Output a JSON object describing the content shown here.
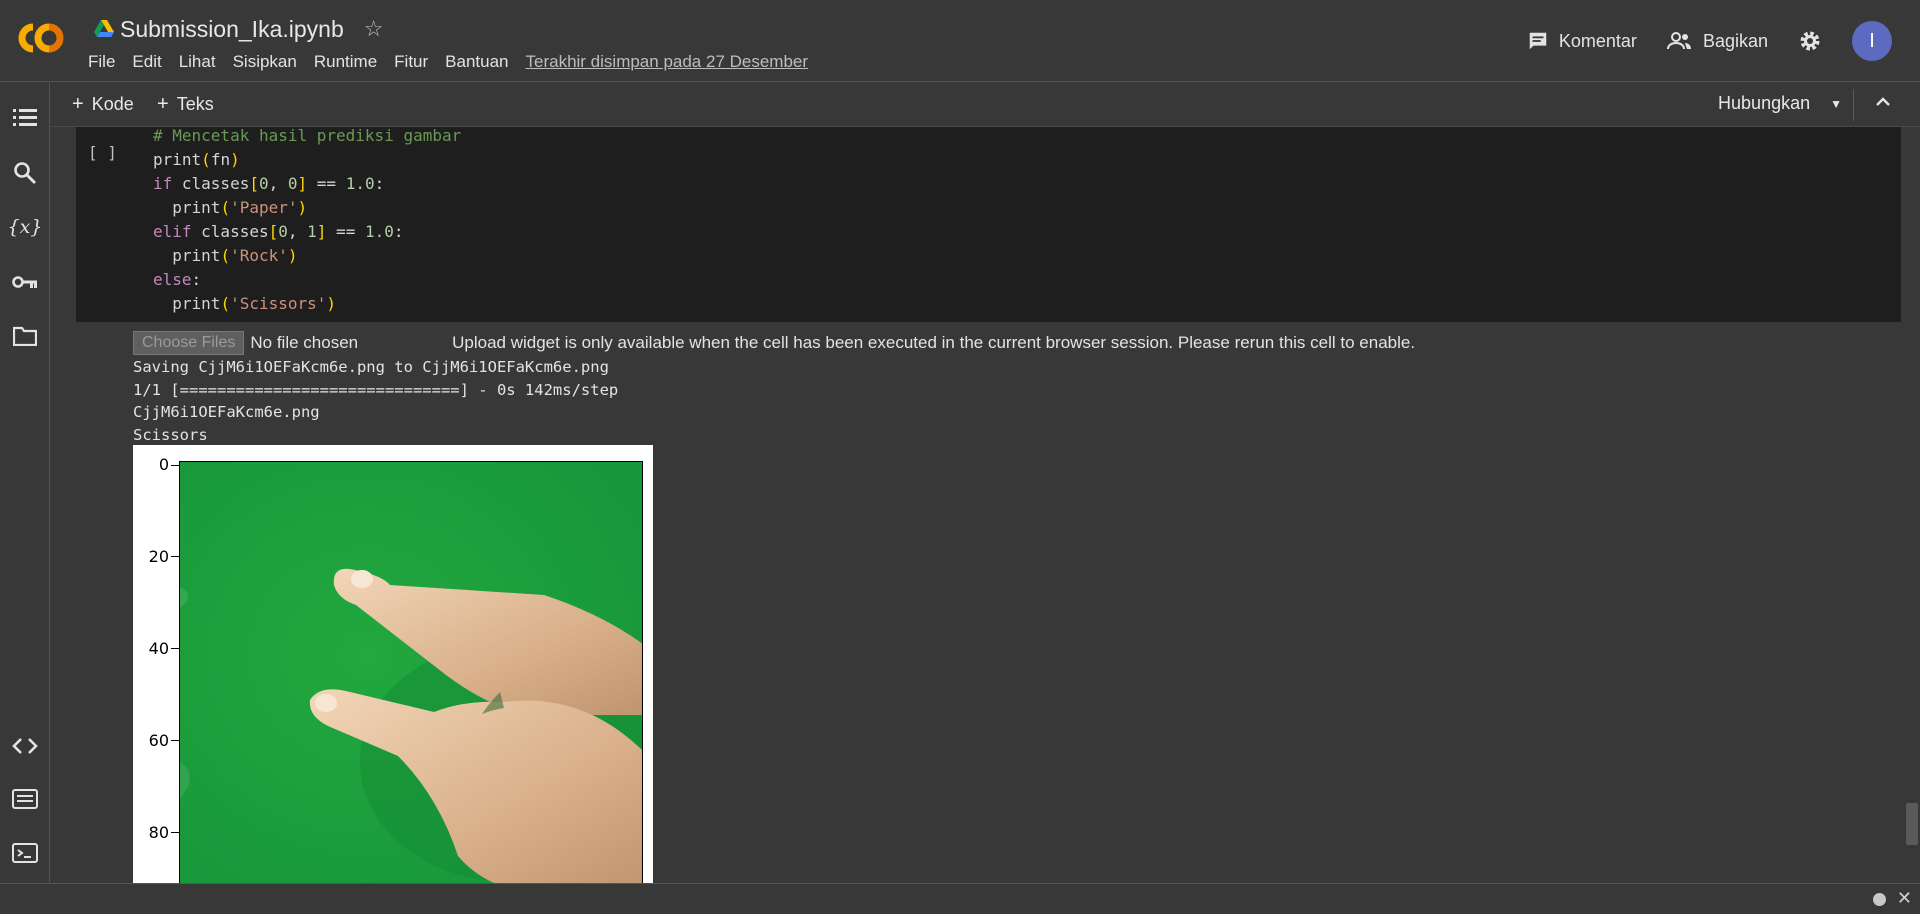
{
  "header": {
    "title": "Submission_Ika.ipynb",
    "menu": [
      "File",
      "Edit",
      "Lihat",
      "Sisipkan",
      "Runtime",
      "Fitur",
      "Bantuan"
    ],
    "saved_status": "Terakhir disimpan pada 27 Desember",
    "comment_label": "Komentar",
    "share_label": "Bagikan",
    "avatar_initial": "I"
  },
  "toolbar": {
    "add_code": "Kode",
    "add_text": "Teks",
    "connect": "Hubungkan"
  },
  "cell": {
    "run_label": "[ ]",
    "code_lines": [
      "# Mencetak hasil prediksi gambar",
      "print(fn)",
      "if classes[0, 0] == 1.0:",
      "  print('Paper')",
      "elif classes[0, 1] == 1.0:",
      "  print('Rock')",
      "else:",
      "  print('Scissors')"
    ]
  },
  "output": {
    "choose_files": "Choose Files",
    "no_file": "No file chosen",
    "upload_message": "Upload widget is only available when the cell has been executed in the current browser session. Please rerun this cell to enable.",
    "lines": [
      "Saving CjjM6i1OEFaKcm6e.png to CjjM6i1OEFaKcm6e.png",
      "1/1 [==============================] - 0s 142ms/step",
      "CjjM6i1OEFaKcm6e.png",
      "Scissors"
    ],
    "plot_yticks": [
      "0",
      "20",
      "40",
      "60",
      "80"
    ]
  },
  "colors": {
    "background": "#383838",
    "cell_background": "#1e1e1e",
    "avatar": "#5c6bc0",
    "logo_orange": "#f9ab00",
    "logo_dark_orange": "#e37400",
    "green_screen": "#1fa33c"
  }
}
